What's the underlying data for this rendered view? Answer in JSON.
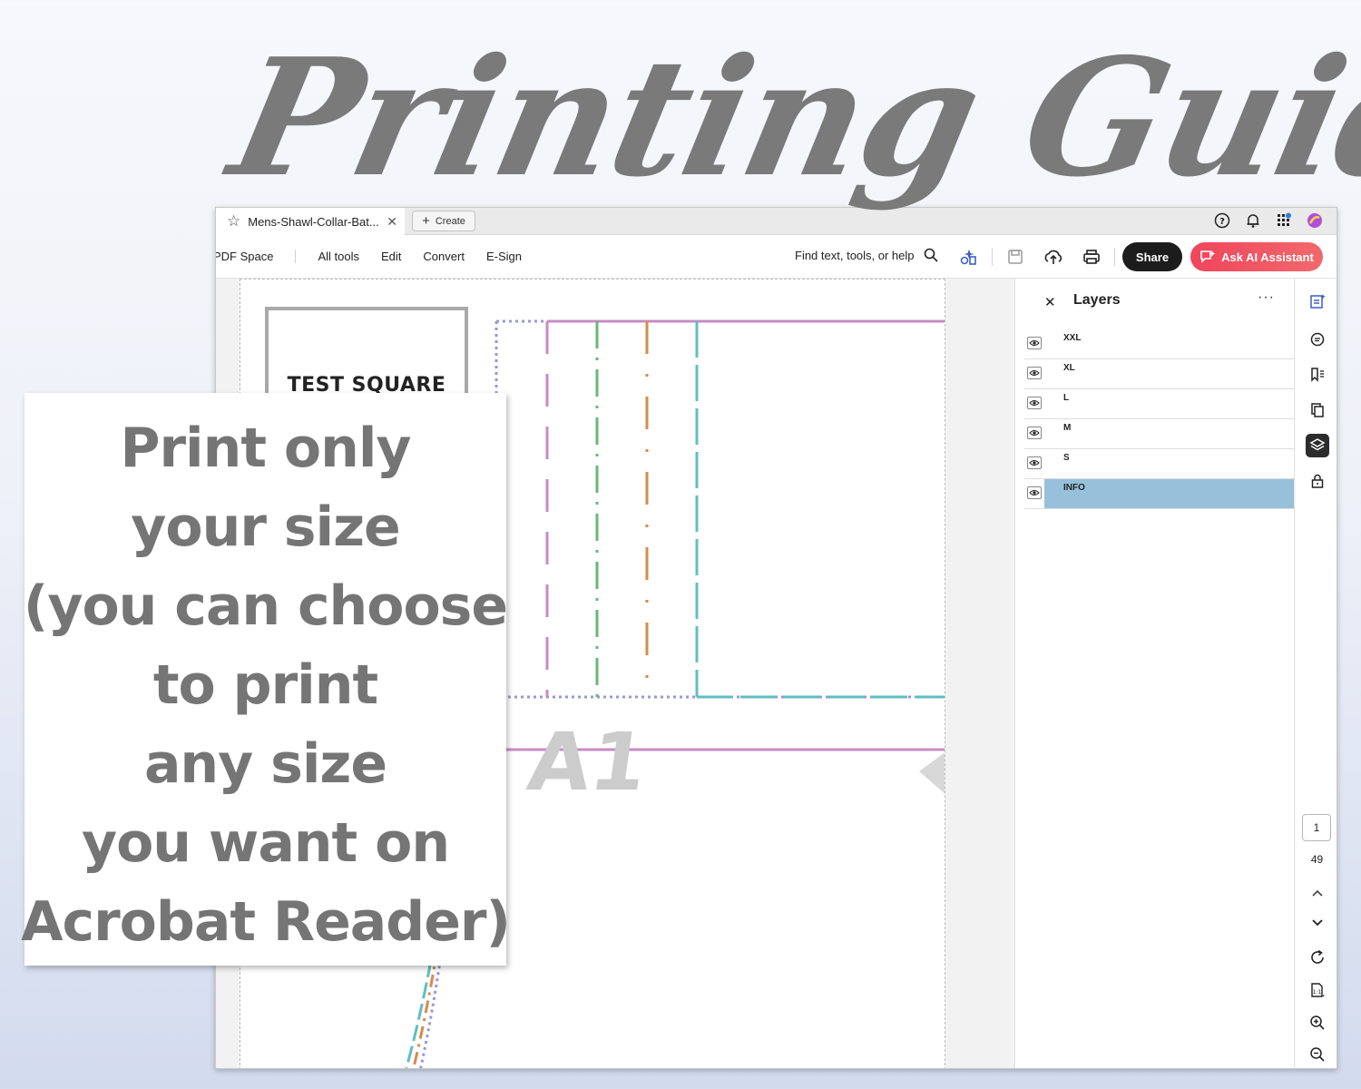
{
  "heading": {
    "title": "Printing Guide"
  },
  "window": {
    "tab": {
      "title": "Mens-Shawl-Collar-Bat...",
      "create_label": "Create"
    },
    "toolbar": {
      "pdf_space": "PDF Space",
      "menu": [
        "All tools",
        "Edit",
        "Convert",
        "E-Sign"
      ],
      "search_placeholder": "Find text, tools, or help",
      "share_label": "Share",
      "ai_assistant_label": "Ask AI Assistant",
      "ai_color": "#f0455b"
    },
    "document": {
      "test_square_label": "TEST SQUARE",
      "piece_label": "A1",
      "line_colors": {
        "xxl": "#9b97d6",
        "xl": "#c78bc6",
        "l": "#64b978",
        "m": "#d98a4a",
        "s": "#5fbec3"
      }
    },
    "layers_panel": {
      "title": "Layers",
      "layers": [
        {
          "name": "XXL",
          "selected": false
        },
        {
          "name": "XL",
          "selected": false
        },
        {
          "name": "L",
          "selected": false
        },
        {
          "name": "M",
          "selected": false
        },
        {
          "name": "S",
          "selected": false
        },
        {
          "name": "INFO",
          "selected": true
        }
      ],
      "selected_color": "#97c0da"
    },
    "pagination": {
      "current": "1",
      "total": "49"
    }
  },
  "callout": {
    "lines": [
      "Print only",
      "your size",
      "(you can choose",
      "to print",
      "any size",
      "you want on",
      "Acrobat Reader)"
    ]
  }
}
